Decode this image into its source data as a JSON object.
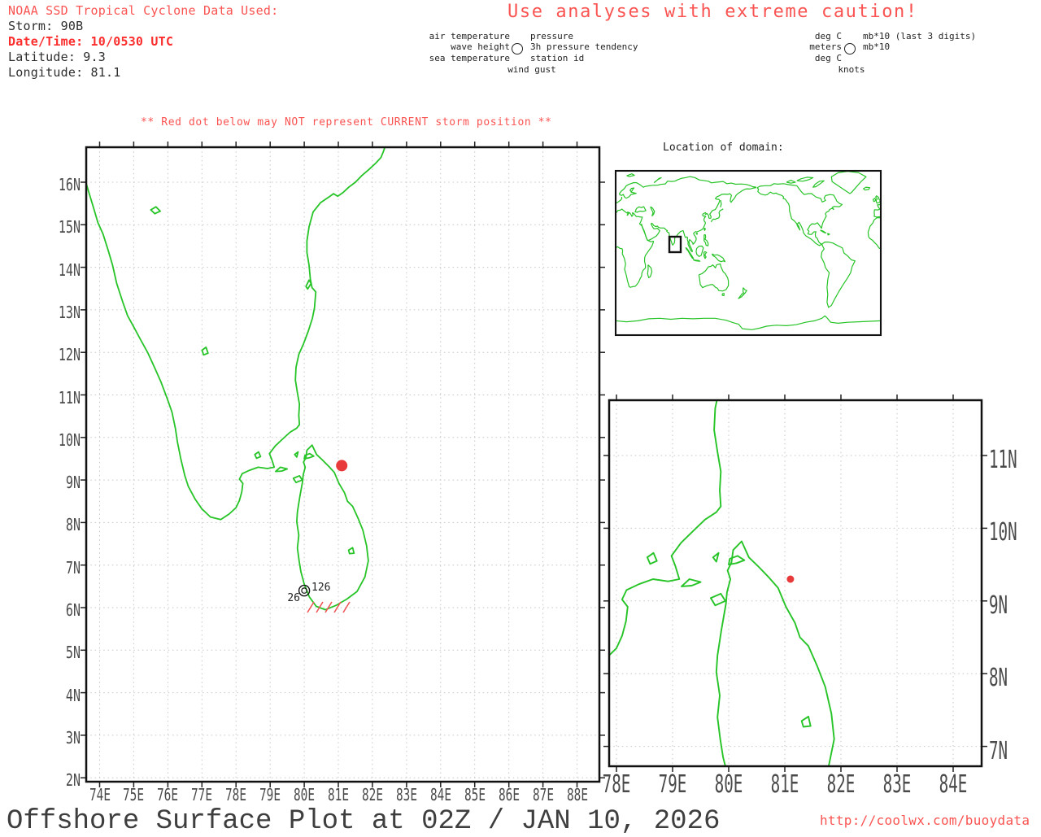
{
  "colors": {
    "text_red": "#fa5452",
    "bold_red": "#fc2d2d",
    "coast_green": "#27c427",
    "storm_dot_red": "#e83a3a",
    "hatch_red": "#ef5858",
    "grid_gray": "#c6c6c6",
    "ink": "#2e2e2e",
    "axis_gray": "#4a4a4a"
  },
  "header": {
    "source_line": "NOAA SSD Tropical Cyclone Data Used:",
    "storm_line": "Storm: 90B",
    "datetime_line": "Date/Time: 10/0530 UTC",
    "latitude_line": "Latitude: 9.3",
    "longitude_line": "Longitude: 81.1"
  },
  "caution_banner": "Use analyses with extreme caution!",
  "station_model_legend": {
    "fields": {
      "air_temperature": "air temperature",
      "wave_height": "wave height",
      "sea_temperature": "sea temperature",
      "wind_gust": "wind gust",
      "pressure": "pressure",
      "pressure_tendency": "3h pressure tendency",
      "station_id": "station id"
    },
    "units": {
      "air_temperature": "deg C",
      "wave_height": "meters",
      "sea_temperature": "deg C",
      "wind_gust": "knots",
      "pressure": "mb*10 (last 3 digits)",
      "pressure_tendency": "mb*10"
    }
  },
  "storm_warning": "** Red dot below may NOT represent CURRENT storm position **",
  "main_map": {
    "x_tick_labels": [
      "74E",
      "75E",
      "76E",
      "77E",
      "78E",
      "79E",
      "80E",
      "81E",
      "82E",
      "83E",
      "84E",
      "85E",
      "86E",
      "87E",
      "88E"
    ],
    "y_tick_labels": [
      "16N",
      "15N",
      "14N",
      "13N",
      "12N",
      "11N",
      "10N",
      "9N",
      "8N",
      "7N",
      "6N",
      "5N",
      "4N",
      "3N",
      "2N"
    ],
    "lon_range": [
      73.6,
      88.6
    ],
    "lat_range": [
      1.9,
      16.8
    ],
    "storm_dot": {
      "lon": 81.1,
      "lat": 9.3
    },
    "station_report": {
      "lon": 80.0,
      "lat": 6.4,
      "temperature": "26",
      "pressure": "126"
    }
  },
  "domain_inset": {
    "title": "Location of domain:"
  },
  "zoom_map": {
    "x_tick_labels": [
      "78E",
      "79E",
      "80E",
      "81E",
      "82E",
      "83E",
      "84E"
    ],
    "y_tick_labels": [
      "11N",
      "10N",
      "9N",
      "8N",
      "7N"
    ],
    "lon_range": [
      77.9,
      84.5
    ],
    "lat_range": [
      6.7,
      11.8
    ],
    "storm_dot": {
      "lon": 81.1,
      "lat": 9.3
    }
  },
  "footer": {
    "title": "Offshore Surface Plot at 02Z / JAN 10, 2026",
    "url": "http://coolwx.com/buoydata"
  }
}
